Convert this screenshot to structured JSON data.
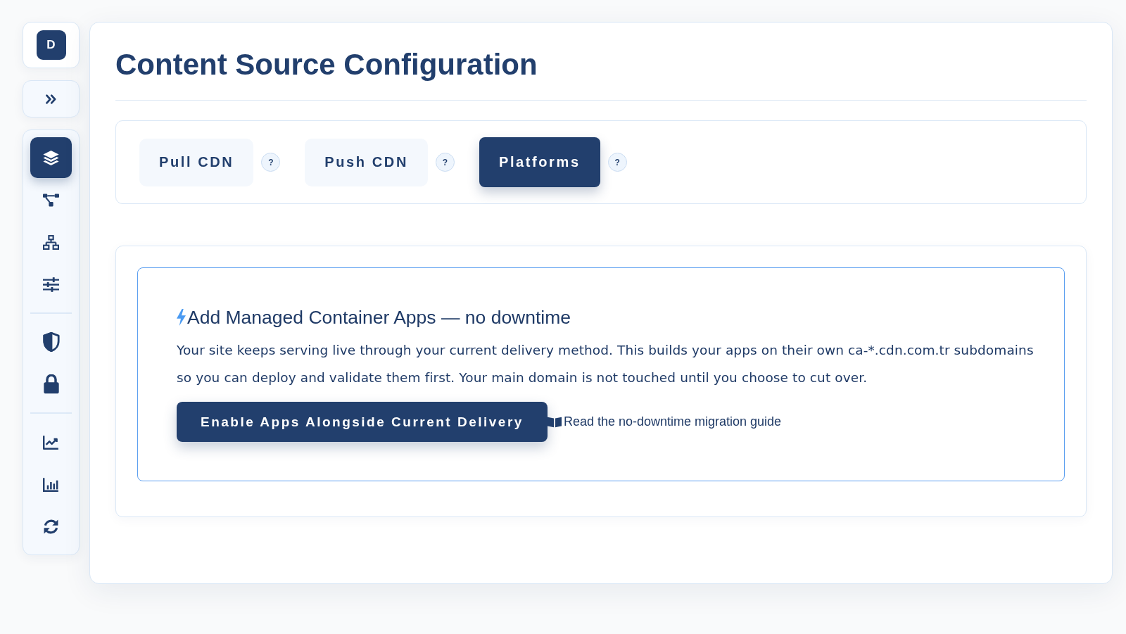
{
  "sidebar": {
    "logo": "D",
    "groups": [
      {
        "items": [
          {
            "selected": true
          },
          {
            "selected": false
          },
          {
            "selected": false
          },
          {
            "selected": false
          }
        ]
      },
      {
        "items": [
          {
            "selected": false
          },
          {
            "selected": false
          }
        ]
      },
      {
        "items": [
          {
            "selected": false
          },
          {
            "selected": false
          },
          {
            "selected": false
          }
        ]
      }
    ]
  },
  "page": {
    "title": "Content Source Configuration"
  },
  "tabs": [
    {
      "label": "Pull CDN",
      "selected": false,
      "help": "?"
    },
    {
      "label": "Push CDN",
      "selected": false,
      "help": "?"
    },
    {
      "label": "Platforms",
      "selected": true,
      "help": "?"
    }
  ],
  "panel": {
    "heading": "Add Managed Container Apps — no downtime",
    "body": "Your site keeps serving live through your current delivery method. This builds your apps on their own ca-*.cdn.com.tr subdomains so you can deploy and validate them first. Your main domain is not touched until you choose to cut over.",
    "button": "Enable Apps Alongside Current Delivery",
    "link": "Read the no-downtime migration guide"
  }
}
